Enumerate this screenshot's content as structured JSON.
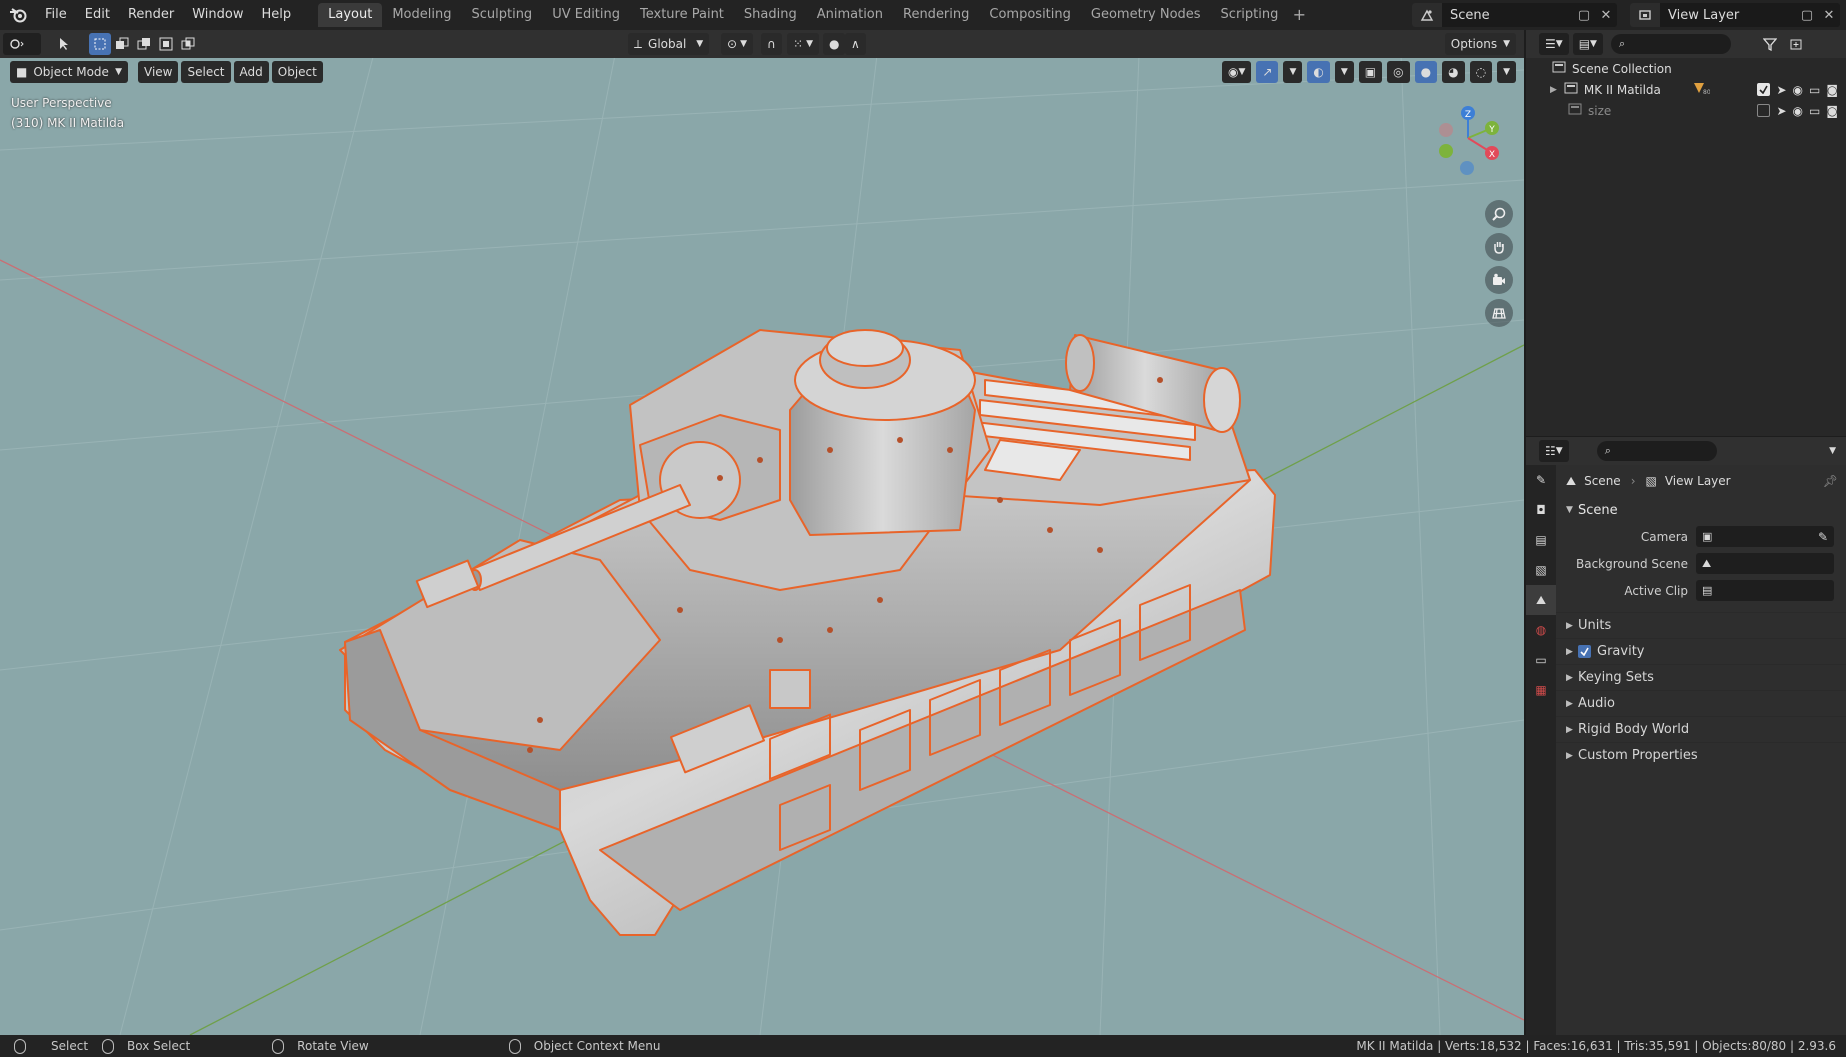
{
  "topbar": {
    "menus": [
      "File",
      "Edit",
      "Render",
      "Window",
      "Help"
    ],
    "workspaces": [
      "Layout",
      "Modeling",
      "Sculpting",
      "UV Editing",
      "Texture Paint",
      "Shading",
      "Animation",
      "Rendering",
      "Compositing",
      "Geometry Nodes",
      "Scripting"
    ],
    "active_workspace": "Layout",
    "scene": "Scene",
    "view_layer": "View Layer"
  },
  "viewport": {
    "transform_orientation": "Global",
    "options_label": "Options",
    "mode": "Object Mode",
    "header_menus": [
      "View",
      "Select",
      "Add",
      "Object"
    ],
    "perspective_label": "User Perspective",
    "object_label": "(310) MK II Matilda",
    "gizmo_axes": {
      "x": "X",
      "y": "Y",
      "z": "Z"
    }
  },
  "outliner": {
    "root": "Scene Collection",
    "items": [
      {
        "name": "MK II Matilda",
        "checked": true
      },
      {
        "name": "size",
        "checked": false
      }
    ]
  },
  "properties": {
    "breadcrumb_scene": "Scene",
    "breadcrumb_view_layer": "View Layer",
    "panel_title": "Scene",
    "fields": [
      {
        "label": "Camera"
      },
      {
        "label": "Background Scene"
      },
      {
        "label": "Active Clip"
      }
    ],
    "subpanels": [
      "Units",
      "Gravity",
      "Keying Sets",
      "Audio",
      "Rigid Body World",
      "Custom Properties"
    ],
    "gravity_enabled": true
  },
  "statusbar": {
    "select": "Select",
    "box_select": "Box Select",
    "rotate_view": "Rotate View",
    "context_menu": "Object Context Menu",
    "stats": "MK II Matilda | Verts:18,532 | Faces:16,631 | Tris:35,591 | Objects:80/80 | 2.93.6"
  },
  "colors": {
    "viewport_bg": "#8aa7a9",
    "selection_outline": "#e8642a",
    "accent": "#4772b3",
    "x_axis": "#e24a5a",
    "y_axis": "#7db33c",
    "z_axis": "#3d7fd6"
  }
}
